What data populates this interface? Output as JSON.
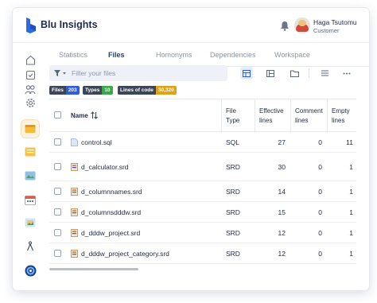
{
  "app": {
    "title": "Blu Insights"
  },
  "user": {
    "name": "Haga Tsutomu",
    "role": "Customer"
  },
  "tabs": [
    {
      "label": "Statistics",
      "active": false
    },
    {
      "label": "Files",
      "active": true
    },
    {
      "label": "Homonyms",
      "active": false
    },
    {
      "label": "Dependencies",
      "active": false
    },
    {
      "label": "Workspace",
      "active": false
    }
  ],
  "search": {
    "placeholder": "Filter your files",
    "value": ""
  },
  "badges": [
    {
      "label": "Files",
      "value": "203",
      "color": "#2d5be3"
    },
    {
      "label": "Types",
      "value": "10",
      "color": "#3aa84a"
    },
    {
      "label": "Lines of code",
      "value": "30,320",
      "color": "#e0a21b"
    }
  ],
  "table": {
    "headers": {
      "name": "Name",
      "file_type": [
        "File",
        "Type"
      ],
      "effective": [
        "Effective",
        "lines"
      ],
      "comment": [
        "Comment",
        "lines"
      ],
      "empty": [
        "Empty",
        "lines"
      ]
    },
    "rows": [
      {
        "name": "control.sql",
        "type": "SQL",
        "effective": "27",
        "comment": "0",
        "empty": "11",
        "icon": "sql-file-icon"
      },
      {
        "name": "d_calculator.srd",
        "type": "SRD",
        "effective": "30",
        "comment": "0",
        "empty": "1",
        "icon": "srd-file-icon"
      },
      {
        "name": "d_columnnames.srd",
        "type": "SRD",
        "effective": "14",
        "comment": "0",
        "empty": "1",
        "icon": "srd-file-icon"
      },
      {
        "name": "d_columnsdddw.srd",
        "type": "SRD",
        "effective": "15",
        "comment": "0",
        "empty": "1",
        "icon": "srd-file-icon"
      },
      {
        "name": "d_dddw_project.srd",
        "type": "SRD",
        "effective": "12",
        "comment": "0",
        "empty": "1",
        "icon": "srd-file-icon"
      },
      {
        "name": "d_dddw_project_category.srd",
        "type": "SRD",
        "effective": "12",
        "comment": "0",
        "empty": "1",
        "icon": "srd-file-icon"
      }
    ]
  },
  "colors": {
    "accent": "#2d5be3",
    "brand": "#1d2b4f"
  }
}
